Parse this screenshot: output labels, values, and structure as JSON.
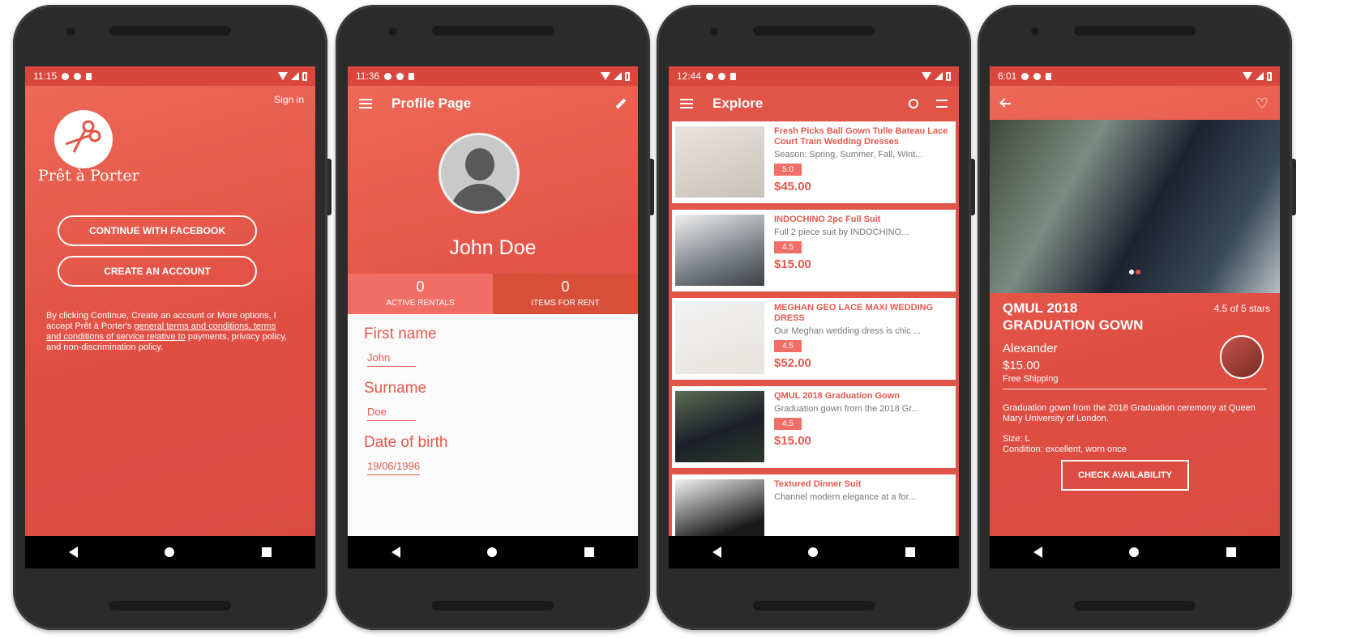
{
  "colors": {
    "primary": "#e35448",
    "status_bar": "#d9473c",
    "accent_light": "#f06e66",
    "nav_bar": "#000000",
    "form_bg": "#fafafa"
  },
  "screen_login": {
    "status_time": "11:15",
    "sign_in": "Sign in",
    "logo_icon": "scissors-icon",
    "logo_text": "Prêt à Porter",
    "facebook_button": "CONTINUE WITH FACEBOOK",
    "create_button": "CREATE AN ACCOUNT",
    "terms_prefix": "By clicking Continue, Create an account or More options, I accept Prêt à Porter's ",
    "terms_link1": "general terms and conditions, terms and conditions of service relative to",
    "terms_suffix": " payments, privacy policy, and non-discrimination policy."
  },
  "screen_profile": {
    "status_time": "11:36",
    "title": "Profile Page",
    "name": "John Doe",
    "stats": [
      {
        "value": "0",
        "label": "ACTIVE RENTALS"
      },
      {
        "value": "0",
        "label": "ITEMS FOR RENT"
      }
    ],
    "fields": [
      {
        "label": "First name",
        "value": "John"
      },
      {
        "label": "Surname",
        "value": "Doe"
      },
      {
        "label": "Date of birth",
        "value": "19/06/1996"
      }
    ]
  },
  "screen_explore": {
    "status_time": "12:44",
    "title": "Explore",
    "items": [
      {
        "title": "Fresh Picks Ball Gown Tulle Bateau Lace Court Train Wedding Dresses",
        "desc": "Season: Spring, Summer, Fall, Wint...",
        "rating": "5.0",
        "price": "$45.00"
      },
      {
        "title": "INDOCHINO 2pc Full Suit",
        "desc": "Full 2 piece suit by INDOCHINO...",
        "rating": "4.5",
        "price": "$15.00"
      },
      {
        "title": "MEGHAN GEO LACE MAXI WEDDING DRESS",
        "desc": "Our Meghan wedding dress is chic ...",
        "rating": "4.5",
        "price": "$52.00"
      },
      {
        "title": "QMUL 2018 Graduation Gown",
        "desc": "Graduation gown from the 2018 Gr...",
        "rating": "4.5",
        "price": "$15.00"
      },
      {
        "title": "Textured Dinner Suit",
        "desc": "Channel modern elegance at a for...",
        "rating": "",
        "price": ""
      }
    ]
  },
  "screen_detail": {
    "status_time": "6:01",
    "title_line1": "QMUL 2018",
    "title_line2": "GRADUATION GOWN",
    "rating": "4.5 of 5 stars",
    "owner": "Alexander",
    "price": "$15.00",
    "shipping": "Free Shipping",
    "description": "Graduation gown from the 2018 Graduation ceremony at Queen Mary University of London.",
    "size": "Size: L",
    "condition": "Condition: excellent, worn once",
    "check_button": "CHECK AVAILABILITY"
  }
}
